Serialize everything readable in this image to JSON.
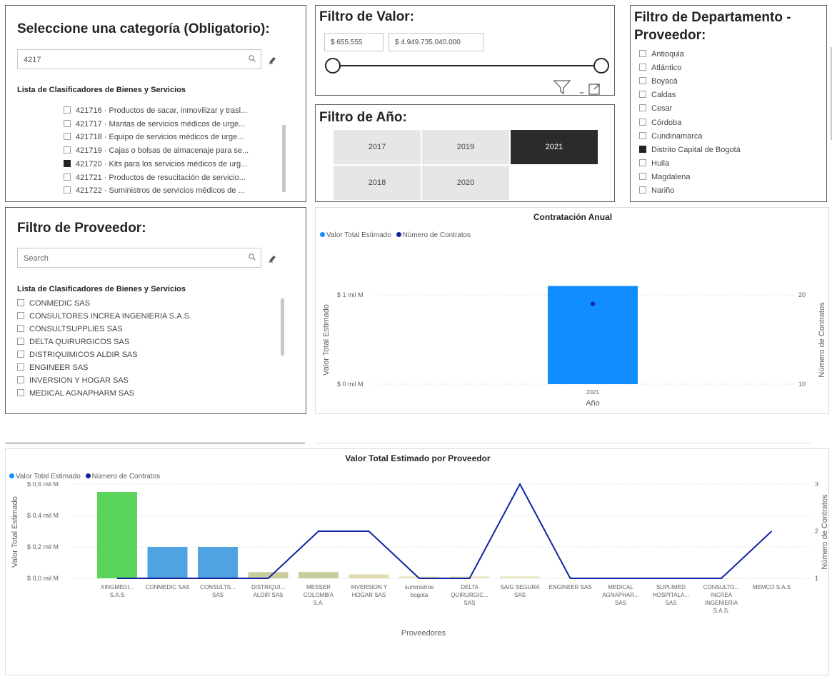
{
  "category_filter": {
    "title": "Seleccione una categoría (Obligatorio):",
    "search_value": "4217",
    "list_header": "Lista de Clasificadores de Bienes y Servicios",
    "items": [
      {
        "label": "421716 · Productos de sacar, inmovilizar y trasl...",
        "checked": false
      },
      {
        "label": "421717 · Mantas de servicios médicos de urge...",
        "checked": false
      },
      {
        "label": "421718 · Equipo de servicios médicos de urge...",
        "checked": false
      },
      {
        "label": "421719 · Cajas o bolsas de almacenaje para se...",
        "checked": false
      },
      {
        "label": "421720 · Kits para los servicios médicos de urg...",
        "checked": true
      },
      {
        "label": "421721 · Productos de resucitación de servicio...",
        "checked": false
      },
      {
        "label": "421722 · Suministros de servicios médicos de ...",
        "checked": false
      }
    ]
  },
  "value_filter": {
    "title": "Filtro de Valor:",
    "min": "$ 655.555",
    "max": "$ 4.949.735.040.000"
  },
  "year_filter": {
    "title": "Filtro de Año:",
    "years": [
      {
        "label": "2017",
        "selected": false
      },
      {
        "label": "2019",
        "selected": false
      },
      {
        "label": "2021",
        "selected": true
      },
      {
        "label": "2018",
        "selected": false
      },
      {
        "label": "2020",
        "selected": false
      }
    ]
  },
  "dept_filter": {
    "title_line1": "Filtro de Departamento -",
    "title_line2": "Proveedor:",
    "items": [
      {
        "label": "Antioquia",
        "checked": false
      },
      {
        "label": "Atlántico",
        "checked": false
      },
      {
        "label": "Boyacá",
        "checked": false
      },
      {
        "label": "Caldas",
        "checked": false
      },
      {
        "label": "Cesar",
        "checked": false
      },
      {
        "label": "Córdoba",
        "checked": false
      },
      {
        "label": "Cundinamarca",
        "checked": false
      },
      {
        "label": "Distrito Capital de Bogotá",
        "checked": true
      },
      {
        "label": "Huila",
        "checked": false
      },
      {
        "label": "Magdalena",
        "checked": false
      },
      {
        "label": "Nariño",
        "checked": false
      }
    ]
  },
  "provider_filter": {
    "title": "Filtro de Proveedor:",
    "search_placeholder": "Search",
    "list_header": "Lista de Clasificadores de Bienes y Servicios",
    "items": [
      {
        "label": "CONMEDIC SAS",
        "checked": false
      },
      {
        "label": "CONSULTORES INCREA INGENIERIA S.A.S.",
        "checked": false
      },
      {
        "label": "CONSULTSUPPLIES SAS",
        "checked": false
      },
      {
        "label": "DELTA QUIRURGICOS SAS",
        "checked": false
      },
      {
        "label": "DISTRIQUIMICOS ALDIR SAS",
        "checked": false
      },
      {
        "label": "ENGINEER SAS",
        "checked": false
      },
      {
        "label": "INVERSION Y HOGAR SAS",
        "checked": false
      },
      {
        "label": "MEDICAL AGNAPHARM SAS",
        "checked": false
      }
    ]
  },
  "chart_data": [
    {
      "type": "bar",
      "title": "Contratación Anual",
      "legend": [
        "Valor Total Estimado",
        "Número de Contratos"
      ],
      "legend_colors": [
        "#118dff",
        "#12239e"
      ],
      "xlabel": "Año",
      "ylabel": "Valor Total Estimado",
      "y2label": "Número de Contratos",
      "categories": [
        "2021"
      ],
      "y_ticks": [
        "$ 1 mil M",
        "$ 0 mil M"
      ],
      "y2_ticks": [
        "20",
        "10"
      ],
      "series": [
        {
          "name": "Valor Total Estimado",
          "values": [
            1.1
          ]
        },
        {
          "name": "Número de Contratos",
          "values": [
            19
          ]
        }
      ],
      "ylim": [
        0,
        1.0
      ],
      "y2lim": [
        10,
        20
      ]
    },
    {
      "type": "bar",
      "title": "Valor Total Estimado por Proveedor",
      "legend": [
        "Valor Total Estimado",
        "Número de Contratos"
      ],
      "legend_colors": [
        "#118dff",
        "#12239e"
      ],
      "xlabel": "Proveedores",
      "ylabel": "Valor Total Estimado",
      "y2label": "Número de Contratos",
      "categories": [
        "XINGMEDI... S.A.S",
        "CONMEDIC SAS",
        "CONSULTS... SAS",
        "DISTRIQUI... ALDIR SAS",
        "MESSER COLOMBIA S.A.",
        "INVERSION Y HOGAR SAS",
        "suministros bogota",
        "DELTA QUIRURGIC... SAS",
        "SAIG SEGURA SAS",
        "ENGINEER SAS",
        "MEDICAL AGNAPHAR... SAS",
        "SUPLIMED HOSPITALA... SAS",
        "CONSULTO... INCREA INGENIERIA S.A.S.",
        "MEMCO S.A.S"
      ],
      "y_ticks": [
        "$ 0,6 mil M",
        "$ 0,4 mil M",
        "$ 0,2 mil M",
        "$ 0,0 mil M"
      ],
      "y2_ticks": [
        "3",
        "2",
        "1"
      ],
      "series": [
        {
          "name": "Valor Total Estimado",
          "values": [
            0.55,
            0.2,
            0.2,
            0.04,
            0.04,
            0.025,
            0.012,
            0.012,
            0.012,
            0.004,
            0.002,
            0.002,
            0.002,
            0.002
          ]
        },
        {
          "name": "Número de Contratos",
          "values": [
            1,
            1,
            1,
            1,
            2,
            2,
            1,
            1,
            3,
            1,
            1,
            1,
            1,
            2
          ]
        }
      ],
      "bar_colors": [
        "#5ad45a",
        "#4fa3e0",
        "#4fa3e0",
        "#c9cc9c",
        "#c9cc9c",
        "#e0dcae",
        "#ebe6c2",
        "#ebe6c2",
        "#ebe6c2",
        "#f0ecd2",
        "#f0ecd2",
        "#f0ecd2",
        "#f0ecd2",
        "#f0ecd2"
      ],
      "ylim": [
        0,
        0.6
      ],
      "y2lim": [
        1,
        3
      ]
    }
  ]
}
